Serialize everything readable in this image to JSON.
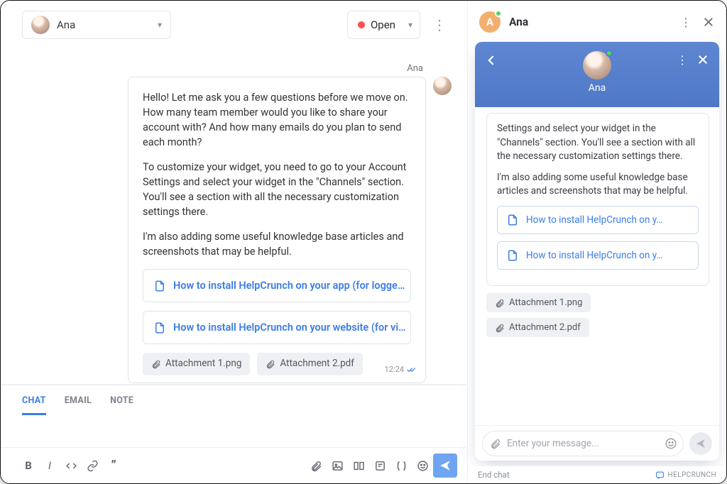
{
  "agent_panel": {
    "assignee": {
      "name": "Ana"
    },
    "status": {
      "label": "Open"
    },
    "message_from": "Ana",
    "message_paragraphs": [
      "Hello! Let me ask you a few questions before we move on. How many team member would you like to share your account with? And how many emails do you plan to send each month?",
      "To customize your widget, you need to go to your Account Settings and select your widget in the \"Channels\" section. You'll see a section with all the necessary customization settings there.",
      "I'm also adding some useful knowledge base articles and screenshots that may be helpful."
    ],
    "link_cards": [
      "How to install HelpCrunch on your app (for logge…",
      "How to install HelpCrunch on your website (for vi…"
    ],
    "attachments": [
      "Attachment 1.png",
      "Attachment 2.pdf"
    ],
    "timestamp": "12:24",
    "composer": {
      "tabs": [
        "CHAT",
        "EMAIL",
        "NOTE"
      ],
      "active_tab_index": 0
    }
  },
  "widget_panel": {
    "header_name": "Ana",
    "header_initial": "A",
    "chat": {
      "agent_name": "Ana",
      "body_paragraphs": [
        "Settings and select your widget in the \"Channels\" section. You'll see a section with all the necessary customization settings there.",
        "I'm also adding some useful knowledge base articles and screenshots that may be helpful."
      ],
      "link_cards": [
        "How to install HelpCrunch on y…",
        "How to install HelpCrunch on y…"
      ],
      "attachments": [
        "Attachment 1.png",
        "Attachment 2.pdf"
      ],
      "input_placeholder": "Enter your message...",
      "end_chat_label": "End chat",
      "brand": "HELPCRUNCH"
    }
  }
}
